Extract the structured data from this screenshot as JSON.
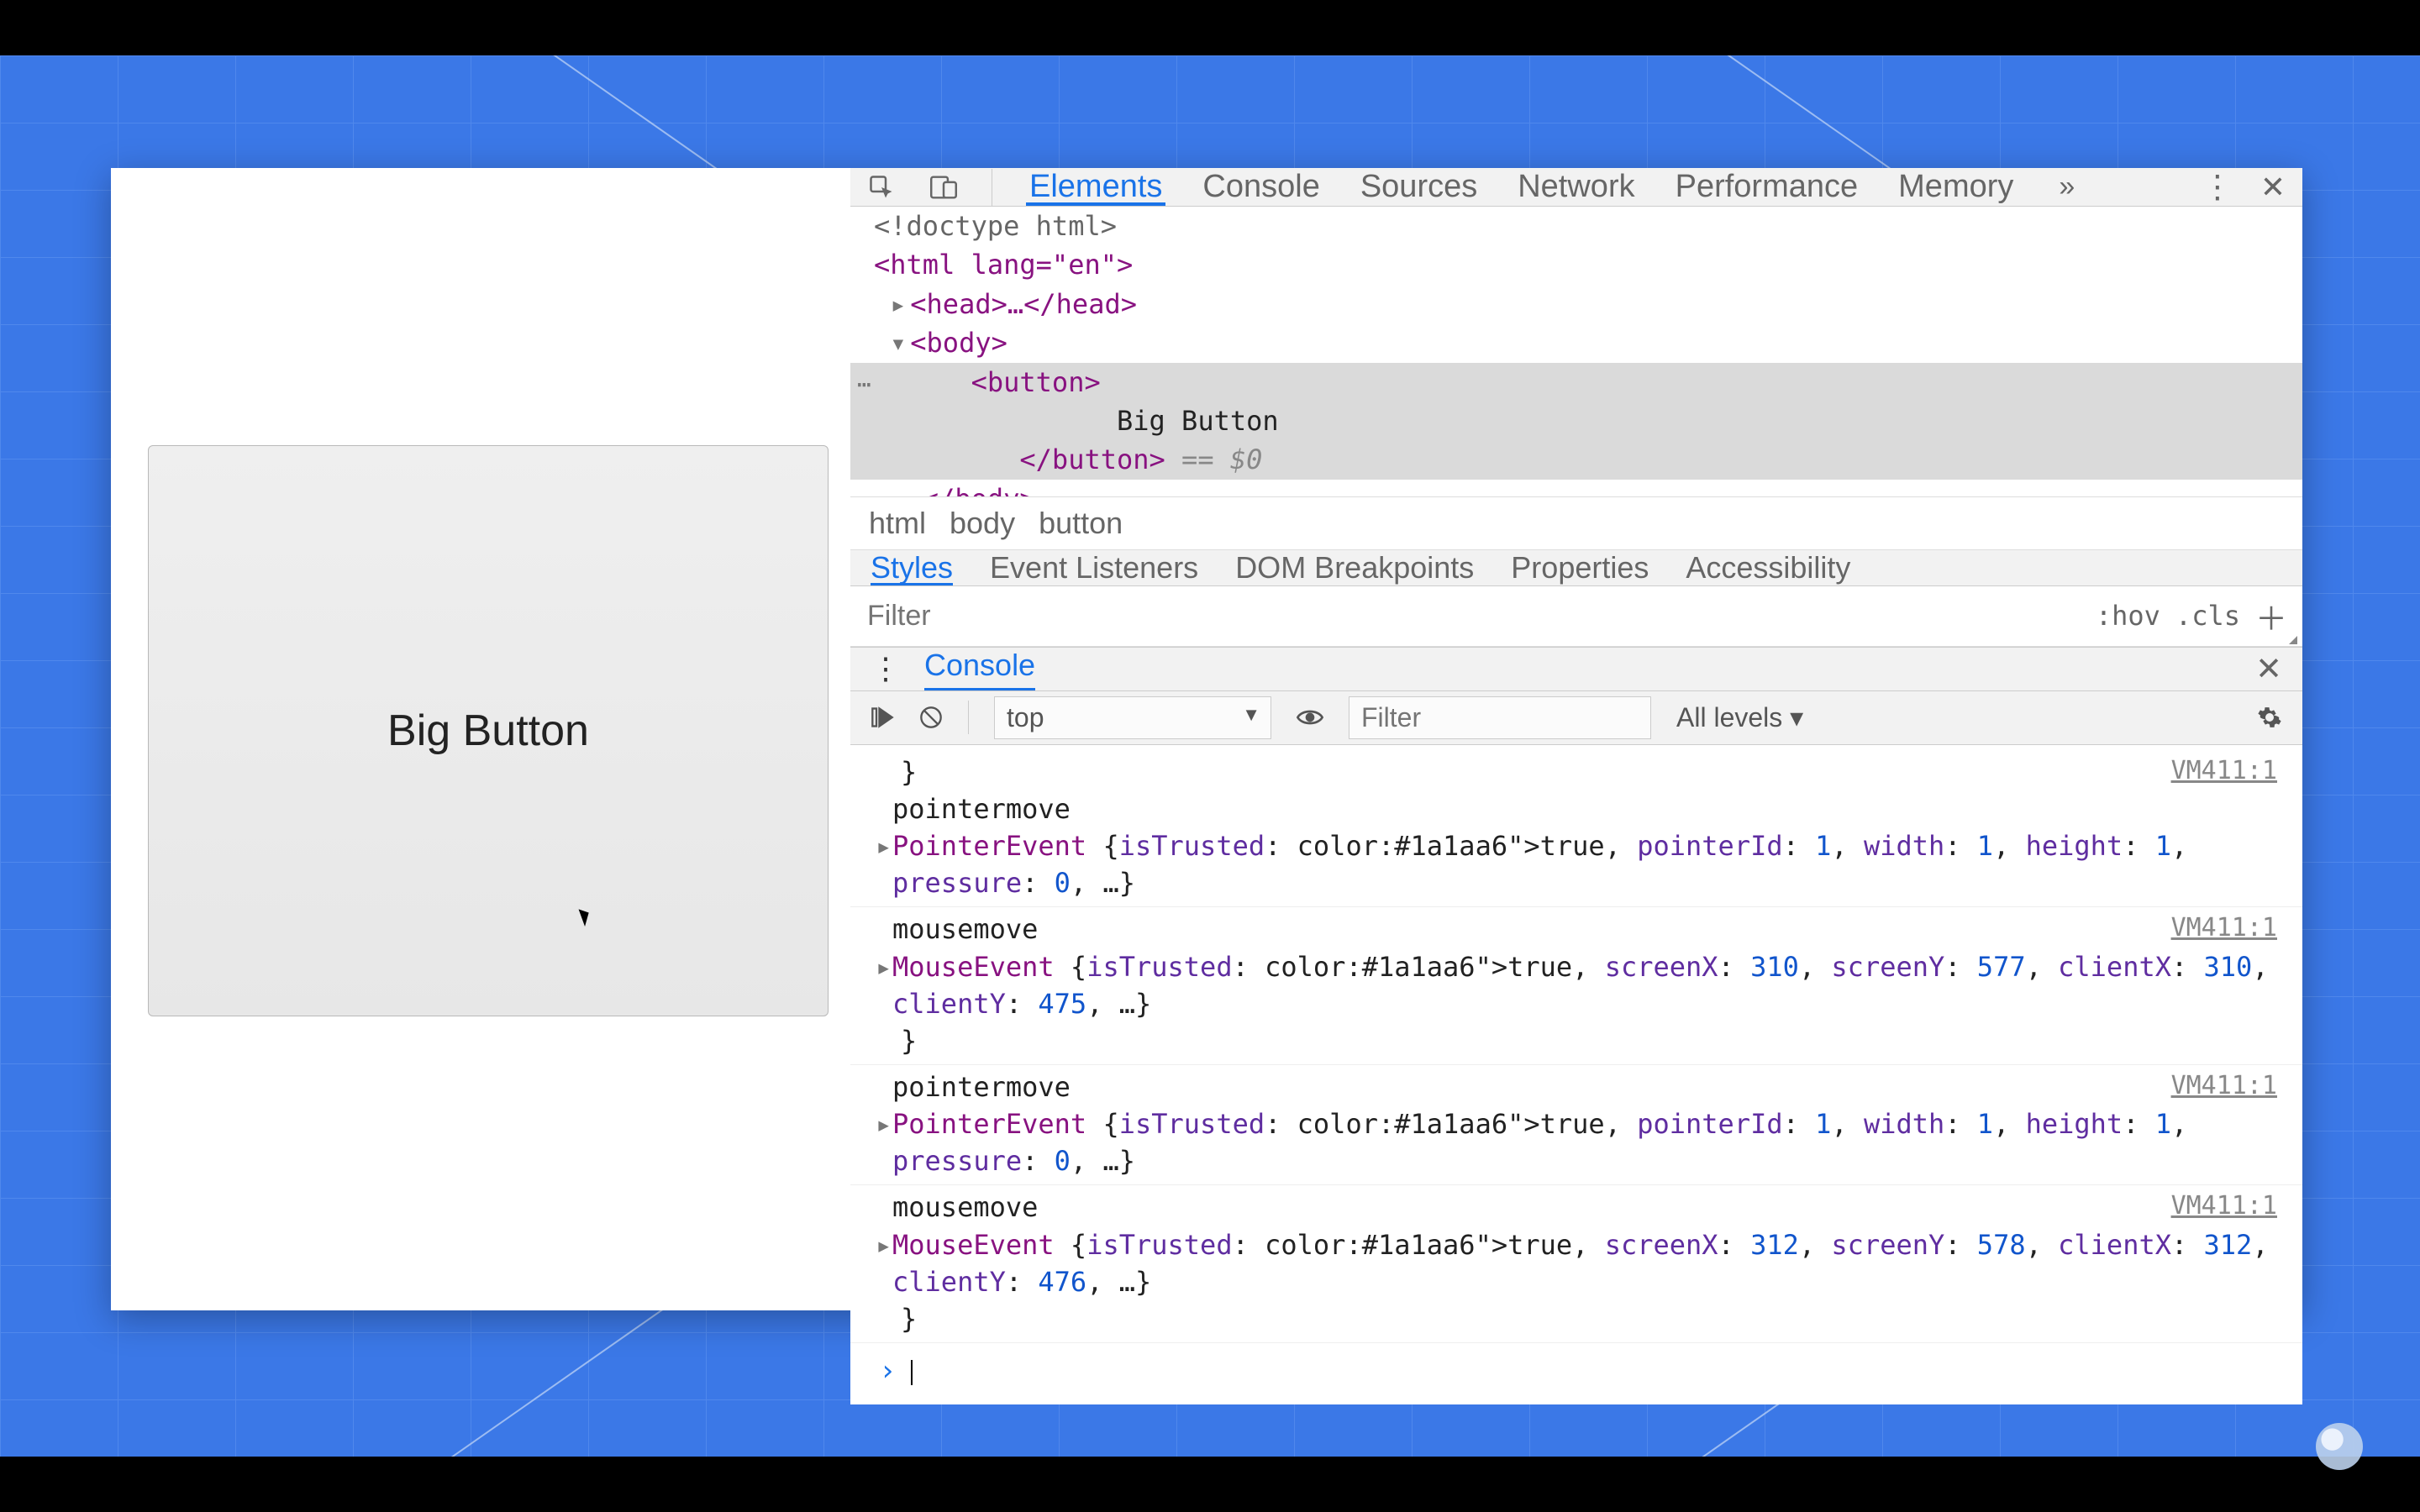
{
  "page": {
    "button_label": "Big Button"
  },
  "devtools": {
    "tabs": [
      "Elements",
      "Console",
      "Sources",
      "Network",
      "Performance",
      "Memory"
    ],
    "active_tab": "Elements",
    "overflow_glyph": "»",
    "dom": {
      "doctype": "<!doctype html>",
      "html_open": "<html lang=\"en\">",
      "head": "<head>…</head>",
      "body_open": "<body>",
      "button_open": "<button>",
      "button_text": "Big Button",
      "button_close": "</button>",
      "selected_suffix": " == $0",
      "body_close_partial": "</body>"
    },
    "breadcrumb": [
      "html",
      "body",
      "button"
    ],
    "subtabs": [
      "Styles",
      "Event Listeners",
      "DOM Breakpoints",
      "Properties",
      "Accessibility"
    ],
    "active_subtab": "Styles",
    "filter_placeholder": "Filter",
    "hov": ":hov",
    "cls": ".cls",
    "console_drawer": {
      "label": "Console",
      "context": "top",
      "filter_placeholder": "Filter",
      "levels": "All levels ▾",
      "entries": [
        {
          "keep_brace": true,
          "name": "pointermove",
          "src": "VM411:1",
          "expand": "PointerEvent {isTrusted: true, pointerId: 1, width: 1, height: 1, pressure: 0, …}"
        },
        {
          "name": "mousemove",
          "src": "VM411:1",
          "expand": "MouseEvent {isTrusted: true, screenX: 310, screenY: 577, clientX: 310, clientY: 475, …}"
        },
        {
          "name": "pointermove",
          "src": "VM411:1",
          "expand": "PointerEvent {isTrusted: true, pointerId: 1, width: 1, height: 1, pressure: 0, …}"
        },
        {
          "name": "mousemove",
          "src": "VM411:1",
          "expand": "MouseEvent {isTrusted: true, screenX: 312, screenY: 578, clientX: 312, clientY: 476, …}"
        }
      ]
    }
  }
}
